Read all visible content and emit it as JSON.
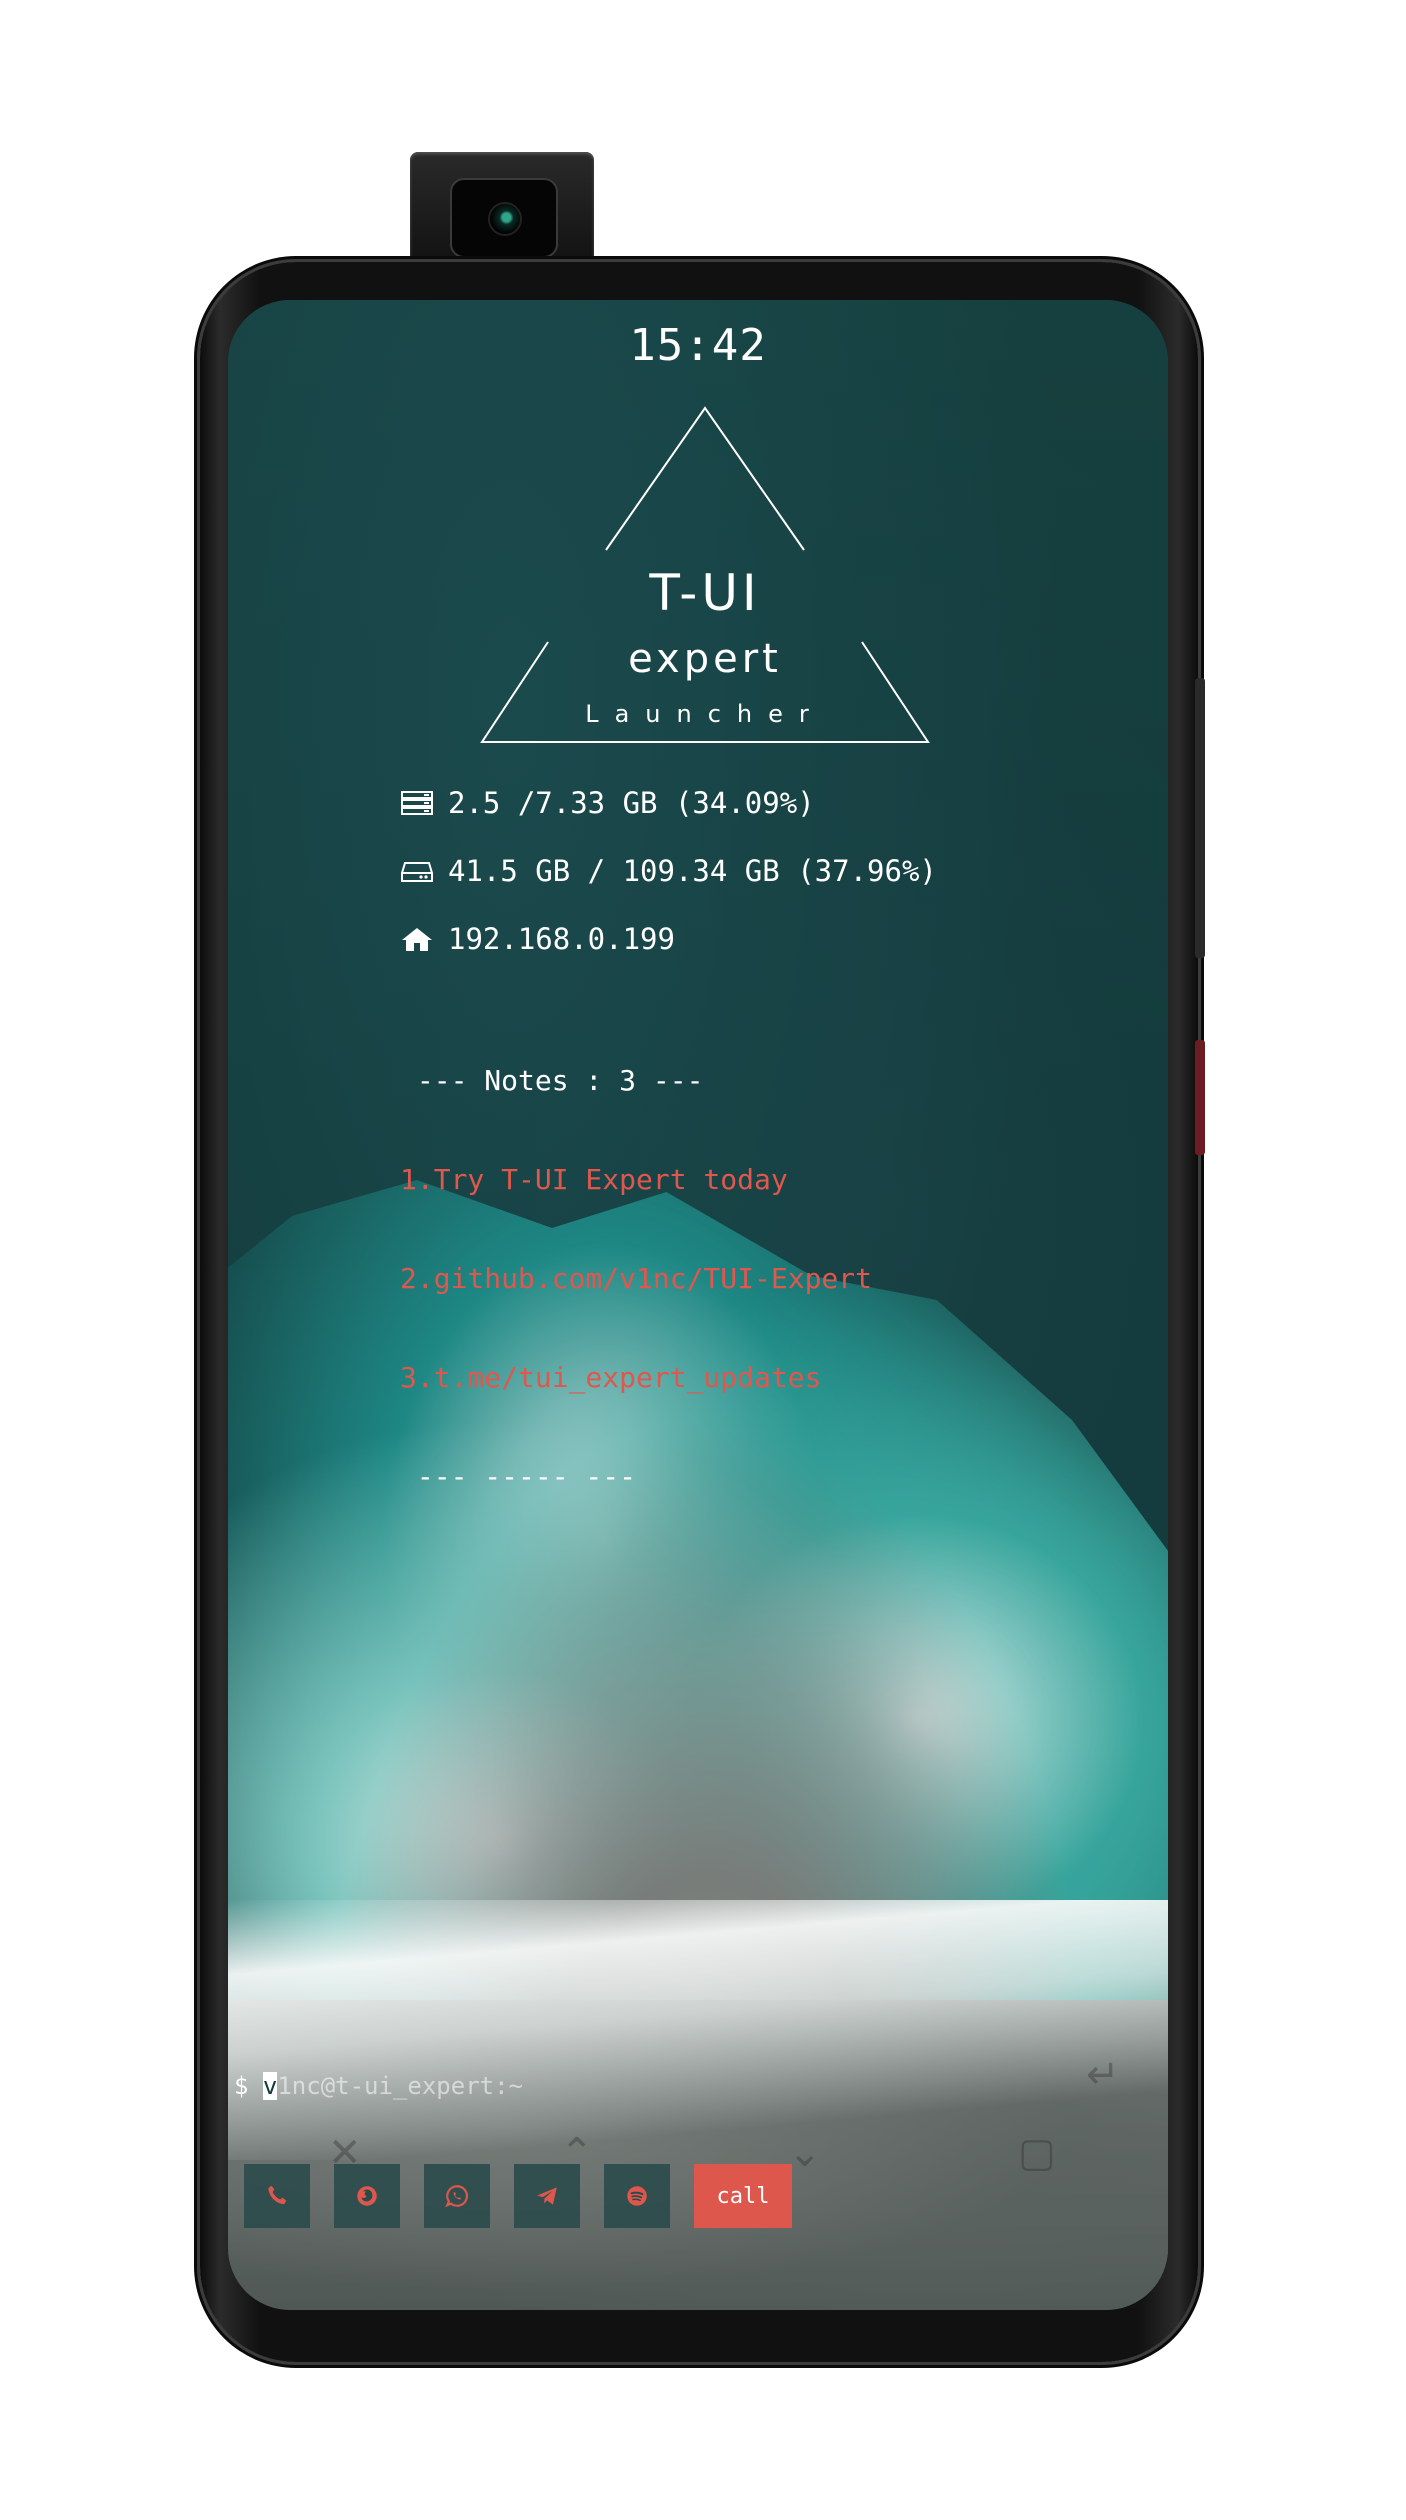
{
  "status": {
    "clock": "15:42"
  },
  "logo": {
    "line1": "T-UI",
    "line2": "expert",
    "line3": "Launcher"
  },
  "info": {
    "ram": {
      "icon": "memory-icon",
      "text": "2.5 /7.33 GB (34.09%)"
    },
    "storage": {
      "icon": "drive-icon",
      "text": "41.5 GB / 109.34 GB (37.96%)"
    },
    "network": {
      "icon": "home-icon",
      "text": "192.168.0.199"
    }
  },
  "notes": {
    "header": " --- Notes : 3 ---",
    "items": [
      "1.Try T-UI Expert today",
      "2.github.com/v1nc/TUI-Expert",
      "3.t.me/tui_expert_updates"
    ],
    "footer": " --- ----- ---"
  },
  "terminal": {
    "prompt_symbol": "$ ",
    "cursor_char": "v",
    "user": "1nc@t-ui_expert:~"
  },
  "dock": {
    "buttons": [
      {
        "icon": "phone-icon"
      },
      {
        "icon": "firefox-icon"
      },
      {
        "icon": "whatsapp-icon"
      },
      {
        "icon": "telegram-icon"
      },
      {
        "icon": "spotify-icon"
      }
    ],
    "call_label": "call"
  },
  "colors": {
    "accent_red": "#de574d",
    "note_red": "#e0574d",
    "text": "#ffffff",
    "dock_bg": "#2a4a4b"
  }
}
